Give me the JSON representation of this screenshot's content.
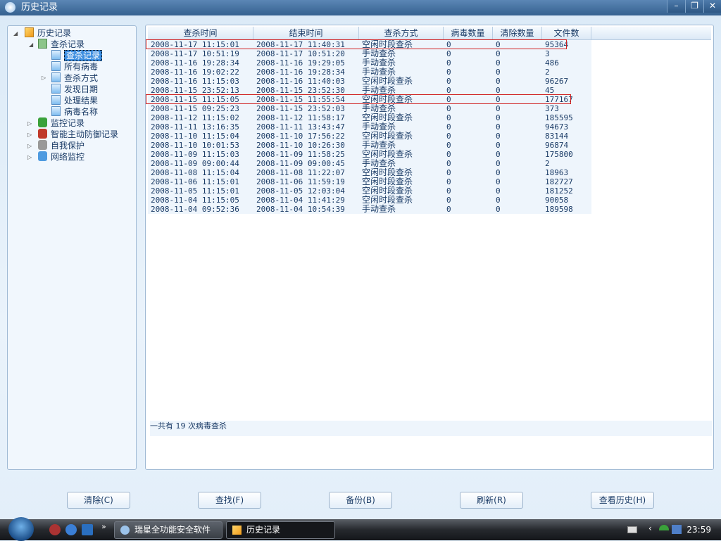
{
  "window": {
    "title": "历史记录",
    "controls": [
      "–",
      "❐",
      "✕"
    ]
  },
  "tree": {
    "root": "历史记录",
    "scan": "查杀记录",
    "scan_children": [
      "查杀记录",
      "所有病毒",
      "查杀方式",
      "发现日期",
      "处理结果",
      "病毒名称"
    ],
    "others": [
      "监控记录",
      "智能主动防御记录",
      "自我保护",
      "网络监控"
    ]
  },
  "table": {
    "columns": [
      "查杀时间",
      "结束时间",
      "查杀方式",
      "病毒数量",
      "清除数量",
      "文件数"
    ],
    "rows": [
      [
        "2008-11-17 11:15:01",
        "2008-11-17 11:40:31",
        "空闲时段查杀",
        "0",
        "0",
        "95364"
      ],
      [
        "2008-11-17 10:51:19",
        "2008-11-17 10:51:20",
        "手动查杀",
        "0",
        "0",
        "3"
      ],
      [
        "2008-11-16 19:28:34",
        "2008-11-16 19:29:05",
        "手动查杀",
        "0",
        "0",
        "486"
      ],
      [
        "2008-11-16 19:02:22",
        "2008-11-16 19:28:34",
        "手动查杀",
        "0",
        "0",
        "2"
      ],
      [
        "2008-11-16 11:15:03",
        "2008-11-16 11:40:03",
        "空闲时段查杀",
        "0",
        "0",
        "96267"
      ],
      [
        "2008-11-15 23:52:13",
        "2008-11-15 23:52:30",
        "手动查杀",
        "0",
        "0",
        "45"
      ],
      [
        "2008-11-15 11:15:05",
        "2008-11-15 11:55:54",
        "空闲时段查杀",
        "0",
        "0",
        "177167"
      ],
      [
        "2008-11-15 09:25:23",
        "2008-11-15 23:52:03",
        "手动查杀",
        "0",
        "0",
        "373"
      ],
      [
        "2008-11-12 11:15:02",
        "2008-11-12 11:58:17",
        "空闲时段查杀",
        "0",
        "0",
        "185595"
      ],
      [
        "2008-11-11 13:16:35",
        "2008-11-11 13:43:47",
        "手动查杀",
        "0",
        "0",
        "94673"
      ],
      [
        "2008-11-10 11:15:04",
        "2008-11-10 17:56:22",
        "空闲时段查杀",
        "0",
        "0",
        "83144"
      ],
      [
        "2008-11-10 10:01:53",
        "2008-11-10 10:26:30",
        "手动查杀",
        "0",
        "0",
        "96874"
      ],
      [
        "2008-11-09 11:15:03",
        "2008-11-09 11:58:25",
        "空闲时段查杀",
        "0",
        "0",
        "175800"
      ],
      [
        "2008-11-09 09:00:44",
        "2008-11-09 09:00:45",
        "手动查杀",
        "0",
        "0",
        "2"
      ],
      [
        "2008-11-08 11:15:04",
        "2008-11-08 11:22:07",
        "空闲时段查杀",
        "0",
        "0",
        "18963"
      ],
      [
        "2008-11-06 11:15:01",
        "2008-11-06 11:59:19",
        "空闲时段查杀",
        "0",
        "0",
        "182727"
      ],
      [
        "2008-11-05 11:15:01",
        "2008-11-05 12:03:04",
        "空闲时段查杀",
        "0",
        "0",
        "181252"
      ],
      [
        "2008-11-04 11:15:05",
        "2008-11-04 11:41:29",
        "空闲时段查杀",
        "0",
        "0",
        "90058"
      ],
      [
        "2008-11-04 09:52:36",
        "2008-11-04 10:54:39",
        "手动查杀",
        "0",
        "0",
        "189598"
      ]
    ],
    "highlighted_rows": [
      0,
      6
    ],
    "summary": "一共有 19 次病毒查杀"
  },
  "buttons": [
    "清除(C)",
    "查找(F)",
    "备份(B)",
    "刷新(R)",
    "查看历史(H)"
  ],
  "taskbar": {
    "tasks": [
      "瑞星全功能安全软件",
      "历史记录"
    ],
    "more": "»",
    "clock": "23:59"
  },
  "colors": {
    "highlight": "#d02020",
    "selection": "#3d8ee0"
  }
}
